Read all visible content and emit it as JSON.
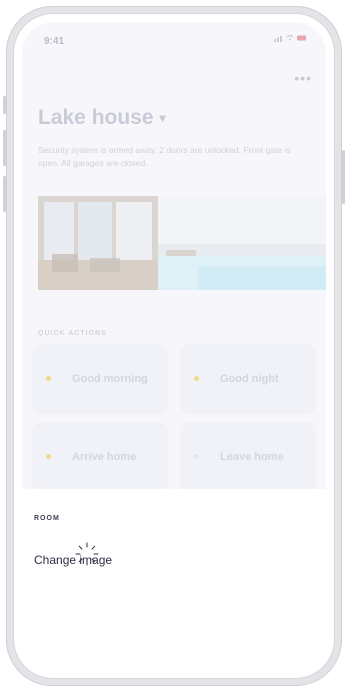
{
  "status": {
    "time": "9:41"
  },
  "header": {
    "title": "Lake house",
    "more_label": "•••"
  },
  "description": "Security system is armed away. 2 doors are unlocked. Front gate is open. All garages are closed.",
  "quick_actions": {
    "label": "QUICK ACTIONS",
    "items": [
      {
        "label": "Good morning",
        "dot_color": "#f2d98a"
      },
      {
        "label": "Good night",
        "dot_color": "#f2d98a"
      },
      {
        "label": "Arrive home",
        "dot_color": "#f2d98a"
      },
      {
        "label": "Leave home",
        "dot_color": "#e4e6ee"
      }
    ]
  },
  "sheet": {
    "section_label": "ROOM",
    "action_label": "Change image"
  }
}
